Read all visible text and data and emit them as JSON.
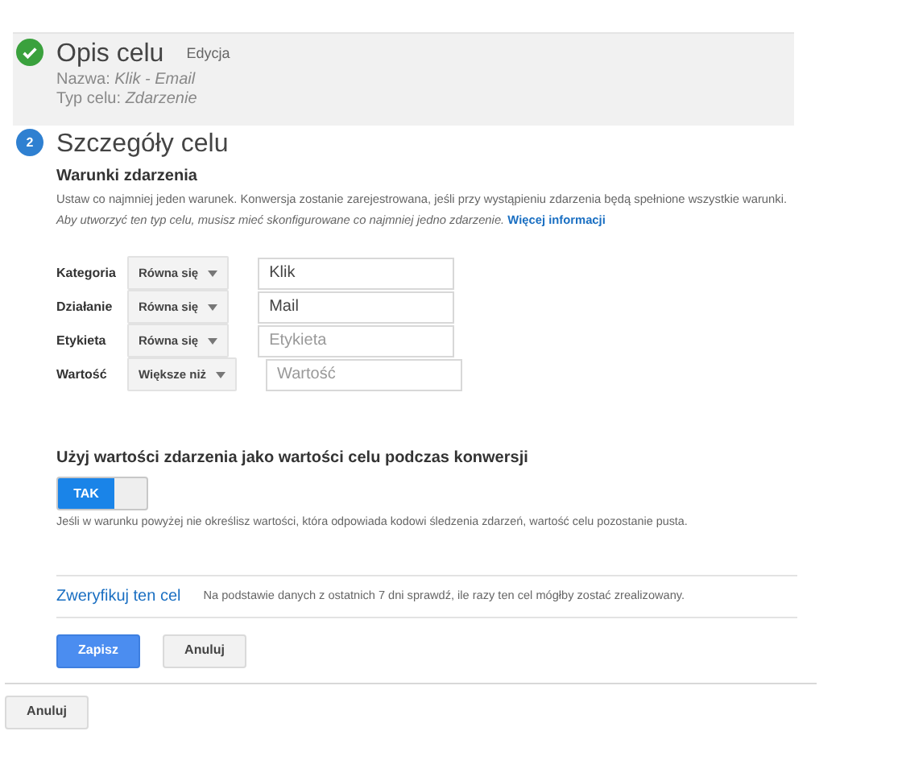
{
  "steps": [
    {
      "completed": true,
      "title": "Opis celu",
      "edit_link": "Edycja",
      "details": [
        {
          "label": "Nazwa:",
          "value": "Klik - Email"
        },
        {
          "label": "Typ celu:",
          "value": "Zdarzenie"
        }
      ]
    },
    {
      "number": "2",
      "completed": false,
      "title": "Szczegóły celu"
    }
  ],
  "conditions": {
    "heading": "Warunki zdarzenia",
    "description": "Ustaw co najmniej jeden warunek. Konwersja zostanie zarejestrowana, jeśli przy wystąpieniu zdarzenia będą spełnione wszystkie warunki. *Aby utworzyć ten typ celu, musisz mieć skonfigurowane co najmniej jedno zdarzenie.*",
    "more_link": "Więcej informacji",
    "rows": [
      {
        "label": "Kategoria",
        "operator": "Równa się",
        "value": "Klik"
      },
      {
        "label": "Działanie",
        "operator": "Równa się",
        "value": "Mail"
      },
      {
        "label": "Etykieta",
        "operator": "Równa się",
        "placeholder": "Etykieta"
      },
      {
        "label": "Wartość",
        "operator": "Większe niż",
        "placeholder": "Wartość"
      }
    ]
  },
  "value_toggle": {
    "label": "Użyj wartości zdarzenia jako wartości celu podczas konwersji",
    "on": true,
    "on_text": "TAK",
    "note": "Jeśli w warunku powyżej nie określisz wartości, która odpowiada kodowi śledzenia zdarzeń, wartość celu pozostanie pusta."
  },
  "verify": {
    "link": "Zweryfikuj ten cel",
    "text": "Na podstawie danych z ostatnich 7 dni sprawdź, ile razy ten cel mógłby zostać zrealizowany."
  },
  "buttons": [
    {
      "label": "Zapisz",
      "kind": "primary"
    },
    {
      "label": "Anuluj",
      "kind": "secondary"
    }
  ],
  "footer_button": "Anuluj"
}
